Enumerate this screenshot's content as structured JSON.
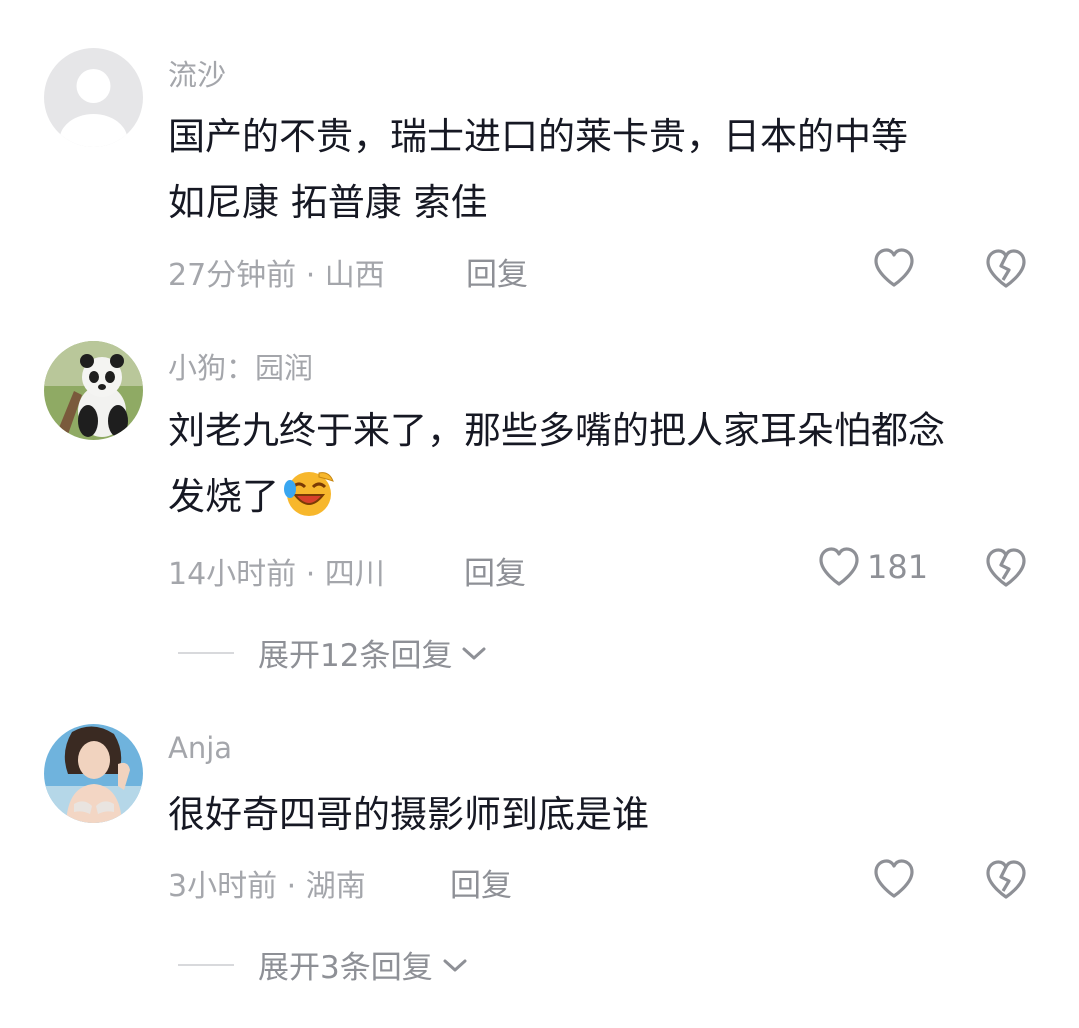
{
  "comments": [
    {
      "username": "流沙",
      "text_line1": "国产的不贵，瑞士进口的莱卡贵，日本的中等",
      "text_line2": "如尼康  拓普康  索佳",
      "time_loc": "27分钟前 · 山西",
      "reply": "回复",
      "likes": ""
    },
    {
      "username": "小狗：园润",
      "text_line1": "刘老九终于来了，那些多嘴的把人家耳朵怕都念",
      "text_line2": "发烧了",
      "time_loc": "14小时前 · 四川",
      "reply": "回复",
      "likes": "181",
      "expand": "展开12条回复"
    },
    {
      "username": "Anja",
      "text_line1": "很好奇四哥的摄影师到底是谁",
      "time_loc": "3小时前 · 湖南",
      "reply": "回复",
      "likes": "",
      "expand": "展开3条回复"
    }
  ],
  "icons": {
    "like": "heart-outline-icon",
    "dislike": "broken-heart-icon",
    "expand": "chevron-down-icon",
    "emoji": "laughing-crying-emoji"
  },
  "colors": {
    "text": "#161823",
    "meta": "#a4a6ab",
    "icon": "#8e9096",
    "emoji": "#f7b72c"
  }
}
